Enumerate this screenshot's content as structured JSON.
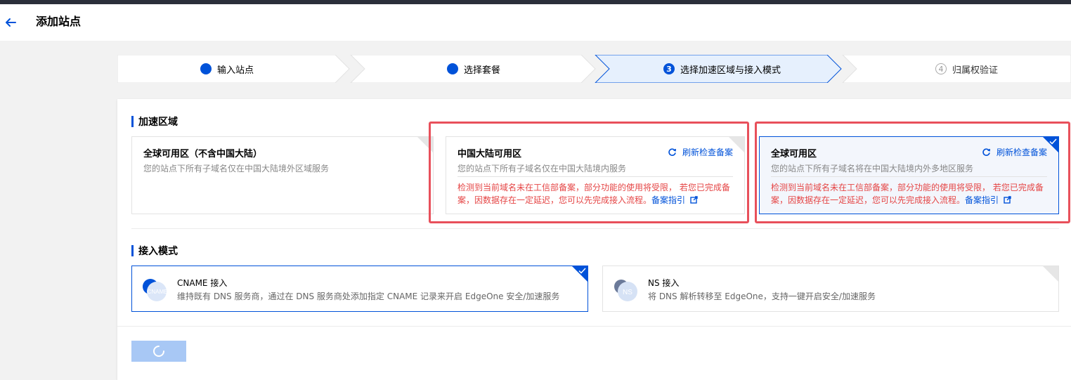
{
  "header": {
    "title": "添加站点",
    "back_icon": "arrow-left-icon"
  },
  "steps": [
    {
      "label": "输入站点",
      "state": "done"
    },
    {
      "label": "选择套餐",
      "state": "done"
    },
    {
      "label": "选择加速区域与接入模式",
      "state": "active",
      "num": "3"
    },
    {
      "label": "归属权验证",
      "state": "todo",
      "num": "4"
    }
  ],
  "region": {
    "title": "加速区域",
    "cards": [
      {
        "title": "全球可用区（不含中国大陆）",
        "desc": "您的站点下所有子域名仅在中国大陆境外区域服务"
      },
      {
        "title": "中国大陆可用区",
        "desc": "您的站点下所有子域名仅在中国大陆境内服务",
        "refresh": "刷新检查备案",
        "warning": "检测到当前域名未在工信部备案，部分功能的使用将受限， 若您已完成备案，因数据存在一定延迟，您可以先完成接入流程。",
        "guide": "备案指引"
      },
      {
        "title": "全球可用区",
        "desc": "您的站点下所有子域名将在中国大陆境内外多地区服务",
        "refresh": "刷新检查备案",
        "warning": "检测到当前域名未在工信部备案，部分功能的使用将受限， 若您已完成备案，因数据存在一定延迟，您可以先完成接入流程。",
        "guide": "备案指引"
      }
    ]
  },
  "mode": {
    "title": "接入模式",
    "cards": [
      {
        "title": "CNAME 接入",
        "desc": "维持既有 DNS 服务商，通过在 DNS 服务商处添加指定 CNAME 记录来开启 EdgeOne 安全/加速服务",
        "icon_text": "CNAME"
      },
      {
        "title": "NS 接入",
        "desc": "将 DNS 解析转移至 EdgeOne，支持一键开启安全/加速服务",
        "icon_text": "NS"
      }
    ]
  },
  "colors": {
    "brand": "#0052d9",
    "warning": "#e54545",
    "highlight": "#e8505b"
  },
  "next_button_state": "loading-spinner-icon"
}
